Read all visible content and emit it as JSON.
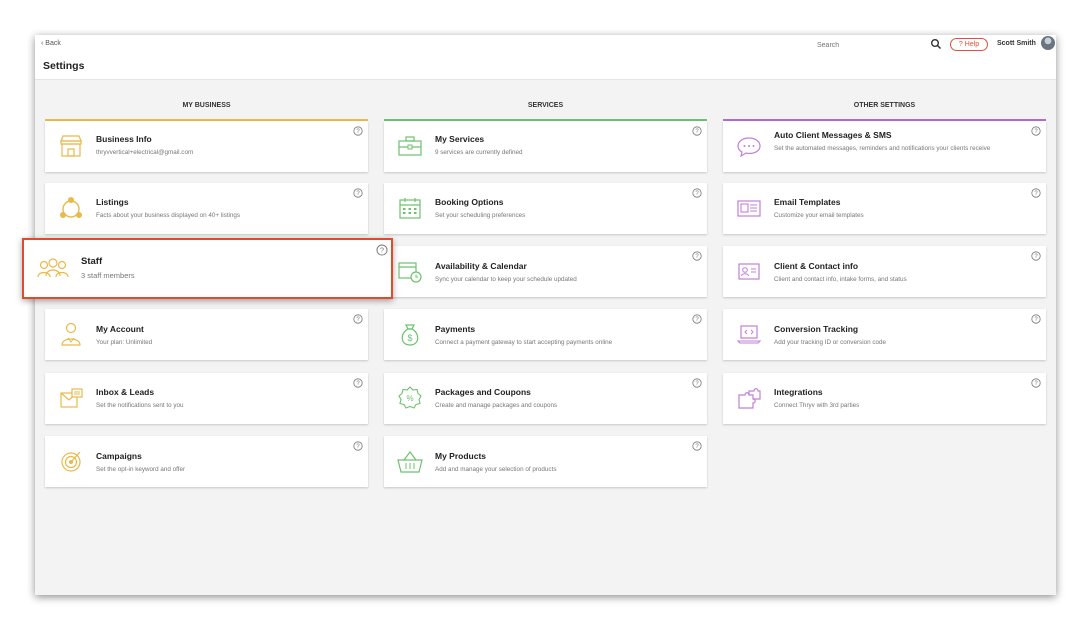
{
  "topbar": {
    "back_label": "‹ Back",
    "page_title": "Settings",
    "search_placeholder": "Search",
    "help_label": "? Help",
    "user_name": "Scott Smith"
  },
  "columns": [
    {
      "header": "MY BUSINESS",
      "accent": "#e9b94a"
    },
    {
      "header": "SERVICES",
      "accent": "#6cc26c"
    },
    {
      "header": "OTHER SETTINGS",
      "accent": "#b26bd1"
    }
  ],
  "my_business": [
    {
      "title": "Business Info",
      "subtitle": "thryvvertical+electrical@gmail.com"
    },
    {
      "title": "Listings",
      "subtitle": "Facts about your business displayed on 40+ listings"
    },
    {
      "title": "Staff",
      "subtitle": "3 staff members"
    },
    {
      "title": "My Account",
      "subtitle": "Your plan: Unlimited"
    },
    {
      "title": "Inbox & Leads",
      "subtitle": "Set the notifications sent to you"
    },
    {
      "title": "Campaigns",
      "subtitle": "Set the opt-in keyword and offer"
    }
  ],
  "services": [
    {
      "title": "My Services",
      "subtitle": "9 services are currently defined"
    },
    {
      "title": "Booking Options",
      "subtitle": "Set your scheduling preferences"
    },
    {
      "title": "Availability & Calendar",
      "subtitle": "Sync your calendar to keep your schedule updated"
    },
    {
      "title": "Payments",
      "subtitle": "Connect a payment gateway to start accepting payments online"
    },
    {
      "title": "Packages and Coupons",
      "subtitle": "Create and manage packages and coupons"
    },
    {
      "title": "My Products",
      "subtitle": "Add and manage your selection of products"
    }
  ],
  "other_settings": [
    {
      "title": "Auto Client Messages & SMS",
      "subtitle": "Set the automated messages, reminders and notifications your clients receive"
    },
    {
      "title": "Email Templates",
      "subtitle": "Customize your email templates"
    },
    {
      "title": "Client & Contact info",
      "subtitle": "Client and contact info, intake forms, and status"
    },
    {
      "title": "Conversion Tracking",
      "subtitle": "Add your tracking ID or conversion code"
    },
    {
      "title": "Integrations",
      "subtitle": "Connect Thryv with 3rd parties"
    }
  ],
  "colors": {
    "highlight_border": "#e24a2c",
    "help_accent": "#e0513b"
  }
}
